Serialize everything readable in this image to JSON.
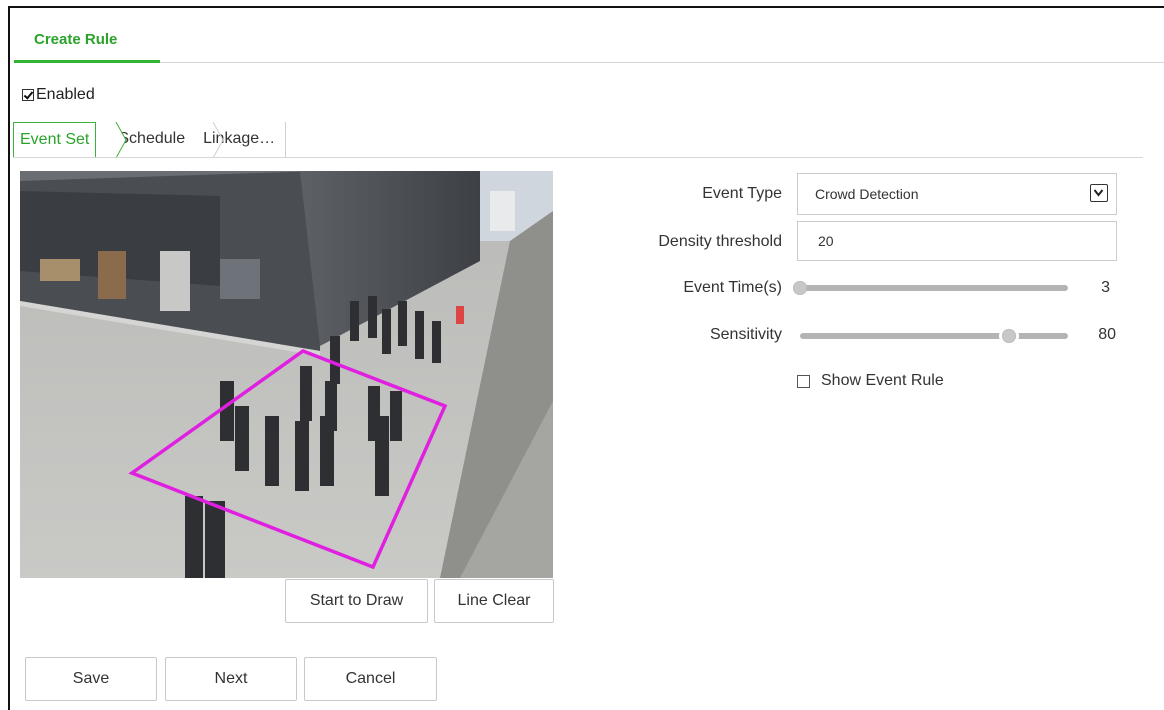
{
  "header": {
    "title": "Create Rule"
  },
  "enabled": {
    "label": "Enabled",
    "checked": true
  },
  "subtabs": [
    {
      "label": "Event Set",
      "active": true
    },
    {
      "label": "Schedule",
      "active": false
    },
    {
      "label": "Linkage…",
      "active": false
    }
  ],
  "video": {
    "overlay_color": "#e020e0"
  },
  "draw_buttons": {
    "start": "Start to Draw",
    "clear": "Line Clear"
  },
  "form": {
    "event_type": {
      "label": "Event Type",
      "value": "Crowd Detection",
      "icon": "chevron-down-icon"
    },
    "density_threshold": {
      "label": "Density threshold",
      "value": "20"
    },
    "event_time": {
      "label": "Event Time(s)",
      "value": "3",
      "fraction": 0.0
    },
    "sensitivity": {
      "label": "Sensitivity",
      "value": "80",
      "fraction": 0.78
    },
    "show_event_rule": {
      "label": "Show Event Rule",
      "checked": false
    }
  },
  "footer": {
    "save": "Save",
    "next": "Next",
    "cancel": "Cancel"
  },
  "colors": {
    "accent": "#32b332",
    "accent_text": "#2aa32a"
  }
}
